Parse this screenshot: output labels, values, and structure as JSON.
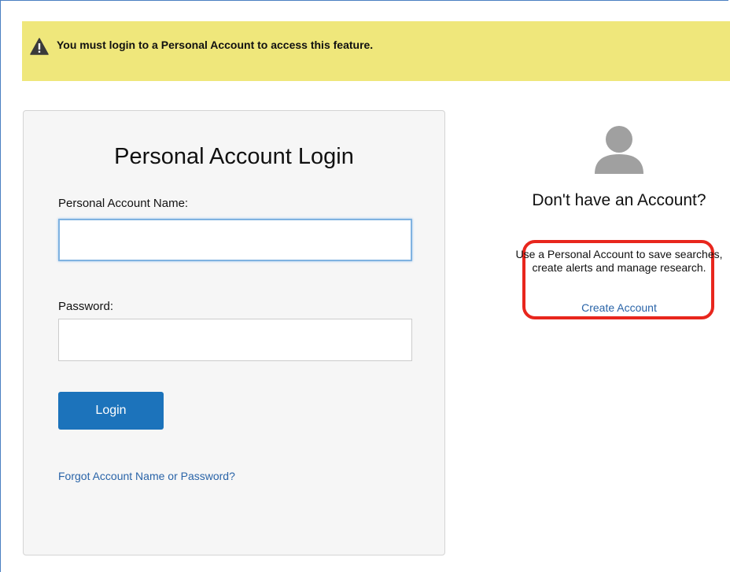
{
  "alert": {
    "icon": "warning-icon",
    "message": "You must login to a Personal Account to access this feature."
  },
  "login": {
    "title": "Personal Account Login",
    "account_name_label": "Personal Account Name:",
    "account_name_value": "",
    "password_label": "Password:",
    "password_value": "",
    "login_button_label": "Login",
    "forgot_link": "Forgot Account Name or Password?"
  },
  "signup": {
    "avatar_icon": "user-avatar-icon",
    "heading": "Don't have an Account?",
    "description": "Use a Personal Account to save searches, create alerts and manage research.",
    "create_link": "Create Account"
  },
  "colors": {
    "alert_background": "#efe77b",
    "primary_button": "#1c73bb",
    "link": "#2a64a8",
    "highlight_border": "#e8261d",
    "avatar": "#a0a0a0"
  }
}
